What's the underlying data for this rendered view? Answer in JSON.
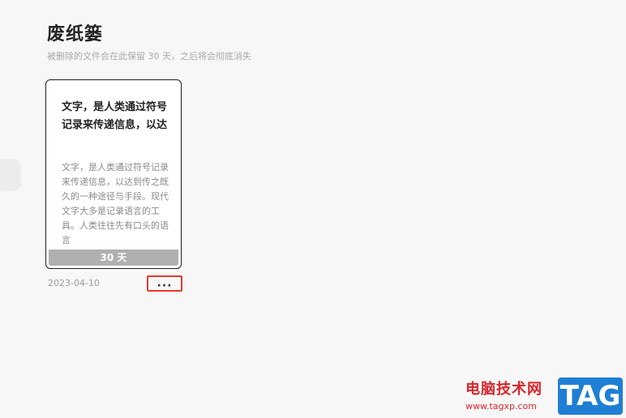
{
  "page": {
    "title": "废纸篓",
    "subtitle": "被删除的文件会在此保留 30 天，之后将会彻底消失"
  },
  "cards": [
    {
      "title": "文字，是人类通过符号记录来传递信息，以达",
      "preview": "文字，是人类通过符号记录来传递信息，以达到传之既久的一种途径与手段。现代文字大多是记录语言的工具。人类往往先有口头的语言",
      "days_left": "30 天",
      "date": "2023-04-10",
      "more_label": "···"
    }
  ],
  "watermark": {
    "text": "电脑技术网",
    "url": "www.tagxp.com",
    "tag": "TAG"
  },
  "colors": {
    "background": "#f7f7f7",
    "highlight_box": "#e53a2e",
    "days_bar": "#b0b0b0",
    "watermark_red": "#d9252b",
    "watermark_blue": "#1f7fd4"
  }
}
